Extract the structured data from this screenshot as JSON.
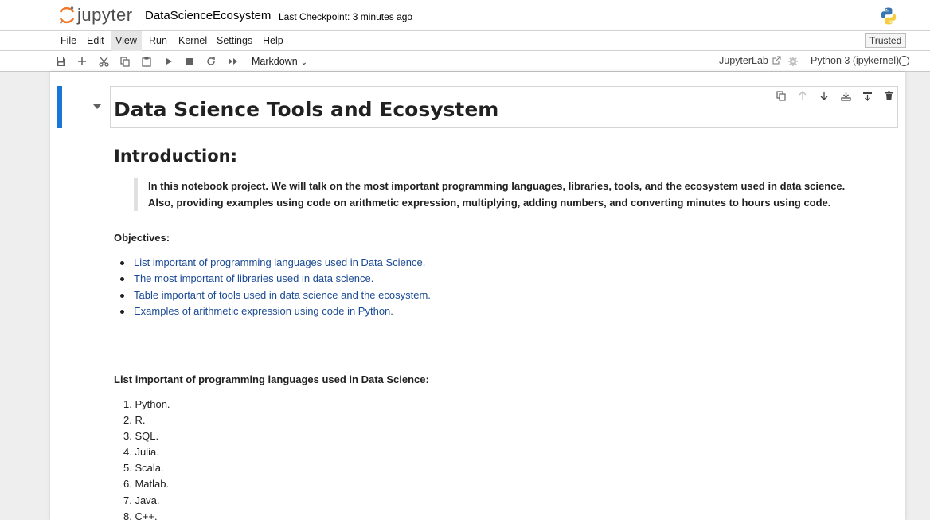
{
  "header": {
    "logo_text": "jupyter",
    "notebook_title": "DataScienceEcosystem",
    "checkpoint": "Last Checkpoint: 3 minutes ago",
    "kernel_logo_icon": "python-logo-icon"
  },
  "menu": {
    "items": [
      "File",
      "Edit",
      "View",
      "Run",
      "Kernel",
      "Settings",
      "Help"
    ],
    "active": "View",
    "trusted": "Trusted"
  },
  "toolbar": {
    "icons": [
      "save-icon",
      "add-cell-icon",
      "cut-icon",
      "copy-icon",
      "paste-icon",
      "run-icon",
      "stop-icon",
      "restart-icon",
      "fast-forward-icon"
    ],
    "cell_type": "Markdown",
    "jupyterlab_link": "JupyterLab",
    "kernel_name": "Python 3 (ipykernel)"
  },
  "cell_toolbar": {
    "icons": [
      "duplicate-icon",
      "move-up-icon",
      "move-down-icon",
      "insert-above-icon",
      "insert-below-icon",
      "delete-icon"
    ]
  },
  "notebook": {
    "title": "Data Science Tools and Ecosystem",
    "intro_heading": "Introduction:",
    "intro_text": "In this notebook project. We will talk on the most important programming languages, libraries, tools, and the ecosystem used in data science. Also, providing examples using code on arithmetic expression, multiplying, adding numbers, and converting minutes to hours using code.",
    "objectives_heading": "Objectives:",
    "objectives": [
      "List important of programming languages used in Data Science.",
      "The most important of libraries used in data science.",
      "Table important of tools used in data science and the ecosystem.",
      "Examples of arithmetic expression using code in Python."
    ],
    "languages_heading": "List important of programming languages used in Data Science:",
    "languages": [
      "1. Python.",
      "2. R.",
      "3. SQL.",
      "4. Julia.",
      "5. Scala.",
      "6. Matlab.",
      "7. Java.",
      "8. C++."
    ]
  }
}
